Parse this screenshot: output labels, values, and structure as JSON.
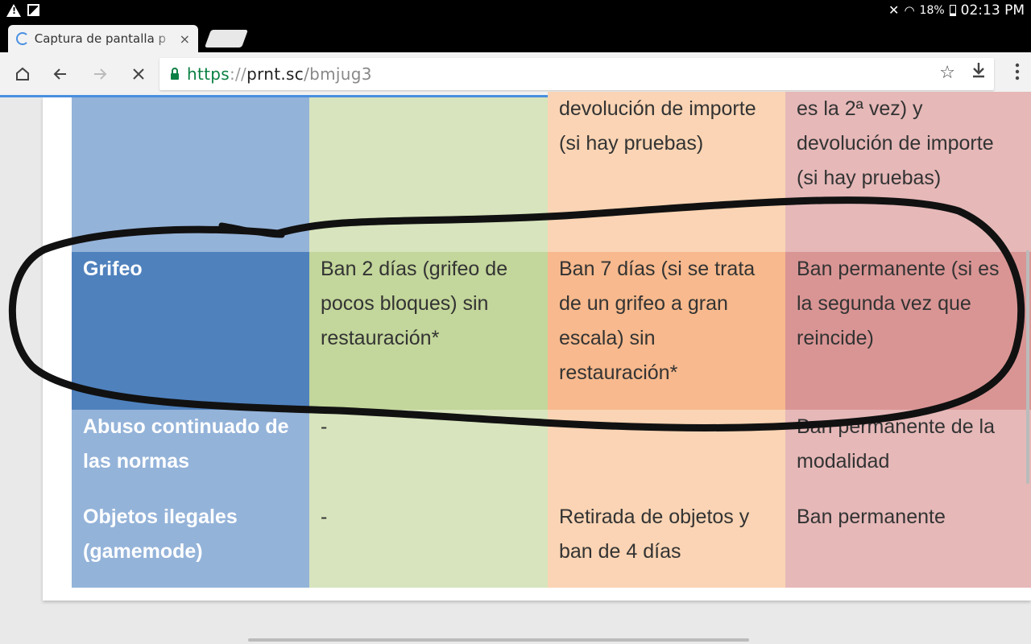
{
  "status_bar": {
    "battery": "18%",
    "time": "02:13 PM"
  },
  "tab": {
    "title": "Captura de pantalla p",
    "close": "×"
  },
  "omnibox": {
    "scheme": "https",
    "separator": "://",
    "host": "prnt.sc",
    "path": "/bmjug3"
  },
  "table": {
    "rows": [
      {
        "c1": "",
        "c2": "",
        "c3": "devolución de importe (si hay pruebas)",
        "c4": "es la 2ª vez) y devolución de importe (si hay pruebas)"
      },
      {
        "c1": "Grifeo",
        "c2": "Ban 2 días (grifeo de pocos bloques) sin restauración*",
        "c3": "Ban 7 días (si se trata de un grifeo a gran escala) sin restauración*",
        "c4": "Ban permanente (si es la segunda vez que reincide)"
      },
      {
        "c1": "Abuso continuado de las normas",
        "c2": "-",
        "c3": "",
        "c4": "Ban permanente de la modalidad"
      },
      {
        "c1": "Objetos ilegales (gamemode)",
        "c2": "-",
        "c3": "Retirada de objetos y ban de 4 días",
        "c4": "Ban permanente"
      }
    ]
  },
  "icons": {
    "home": "home-icon",
    "back": "back-arrow-icon",
    "forward": "forward-arrow-icon",
    "stop": "close-icon",
    "bookmark": "star-icon",
    "download": "download-icon",
    "menu": "more-vert-icon"
  }
}
